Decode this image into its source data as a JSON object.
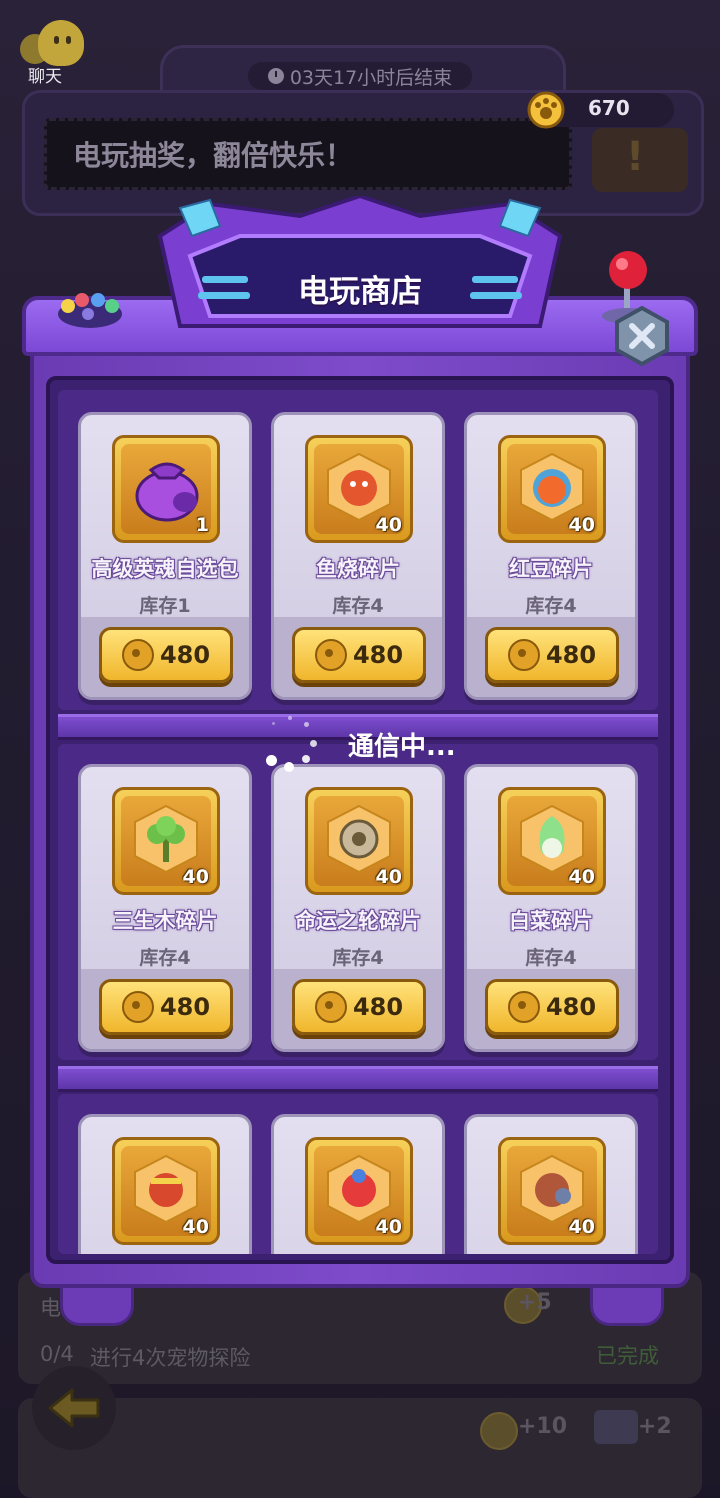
{
  "chat": {
    "label": "聊天"
  },
  "event": {
    "timer": "03天17小时后结束",
    "banner": "电玩抽奖，翻倍快乐！",
    "coins": "670"
  },
  "shop": {
    "title": "电玩商店",
    "items": [
      {
        "name": "高级英魂自选包",
        "stock": "库存1",
        "qty": "1",
        "price": "480",
        "icon": "purple-hero-soul-bag-icon"
      },
      {
        "name": "鱼烧碎片",
        "stock": "库存4",
        "qty": "40",
        "price": "480",
        "icon": "fish-bake-pet-icon"
      },
      {
        "name": "红豆碎片",
        "stock": "库存4",
        "qty": "40",
        "price": "480",
        "icon": "red-bean-pet-icon"
      },
      {
        "name": "三生木碎片",
        "stock": "库存4",
        "qty": "40",
        "price": "480",
        "icon": "tree-pet-icon"
      },
      {
        "name": "命运之轮碎片",
        "stock": "库存4",
        "qty": "40",
        "price": "480",
        "icon": "wheel-of-fate-icon"
      },
      {
        "name": "白菜碎片",
        "stock": "库存4",
        "qty": "40",
        "price": "480",
        "icon": "cabbage-pet-icon"
      },
      {
        "qty": "40",
        "icon": "red-warrior-pet-icon"
      },
      {
        "qty": "40",
        "icon": "lion-dance-pet-icon"
      },
      {
        "qty": "40",
        "icon": "armored-pet-icon"
      }
    ]
  },
  "loading": {
    "text": "通信中..."
  },
  "tasks": [
    {
      "title": "电",
      "progress": "0/4",
      "desc": "进行4次宠物探险",
      "status": "已完成",
      "reward": "+5"
    },
    {
      "title": "",
      "progress": "",
      "desc": "",
      "reward": "+10",
      "reward2": "+2"
    }
  ],
  "colors": {
    "accent": "#7e4ccb",
    "gold": "#f0b62c",
    "card": "#e3dff0"
  }
}
